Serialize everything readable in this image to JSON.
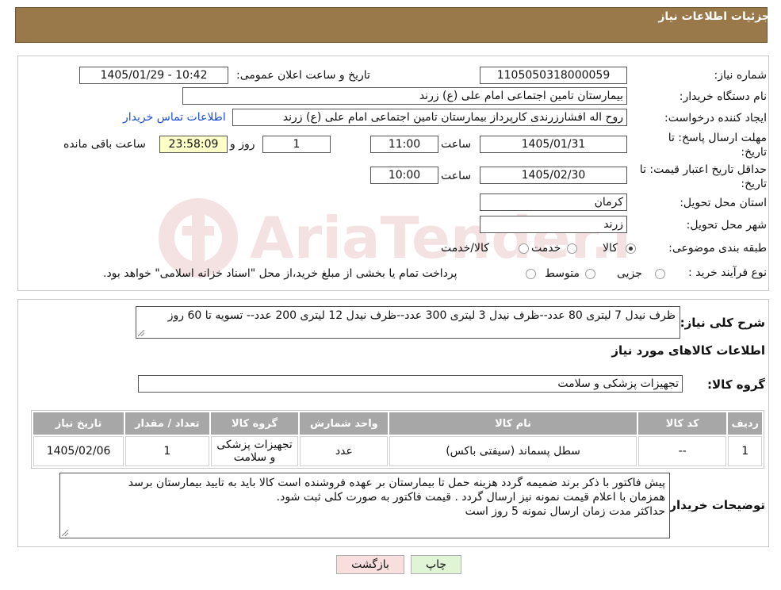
{
  "header": {
    "title": "جزئیات اطلاعات نیاز"
  },
  "fields": {
    "need_number_label": "شماره نیاز:",
    "need_number": "1105050318000059",
    "announce_label": "تاریخ و ساعت اعلان عمومی:",
    "announce_value": "1405/01/29 - 10:42",
    "buyer_org_label": "نام دستگاه خریدار:",
    "buyer_org": "بیمارستان تامین اجتماعی امام علی (ع) زرند",
    "requester_label": "ایجاد کننده درخواست:",
    "requester": "روح اله افشارزرندی کارپرداز بیمارستان تامین اجتماعی امام علی (ع) زرند",
    "contact_link": "اطلاعات تماس خریدار",
    "reply_deadline_label_1": "مهلت ارسال پاسخ: تا",
    "reply_deadline_label_2": "تاریخ:",
    "reply_date": "1405/01/31",
    "time_label": "ساعت",
    "reply_time": "11:00",
    "days_value": "1",
    "days_label": "روز و",
    "remaining_time": "23:58:09",
    "remaining_label": "ساعت باقی مانده",
    "validity_label_1": "حداقل تاریخ اعتبار قیمت: تا",
    "validity_label_2": "تاریخ:",
    "validity_date": "1405/02/30",
    "validity_time": "10:00",
    "province_label": "استان محل تحویل:",
    "province": "کرمان",
    "city_label": "شهر محل تحویل:",
    "city": "زرند",
    "category_label": "طبقه بندی موضوعی:",
    "category_options": [
      "کالا",
      "خدمت",
      "کالا/خدمت"
    ],
    "category_selected": "کالا",
    "purchase_type_label": "نوع فرآیند خرید :",
    "purchase_options": [
      "جزیی",
      "متوسط"
    ],
    "purchase_note": "پرداخت تمام یا بخشی از مبلغ خرید،از محل \"اسناد خزانه اسلامی\" خواهد بود."
  },
  "description": {
    "label": "شرح کلی نیاز:",
    "text": "ظرف نیدل 7 لیتری 80 عدد--ظرف نیدل 3 لیتری 300 عدد--ظرف نیدل 12 لیتری 200 عدد-- تسویه تا 60 روز"
  },
  "goods": {
    "section_title": "اطلاعات کالاهای مورد نیاز",
    "group_label": "گروه کالا:",
    "group_value": "تجهیزات پزشکی و سلامت",
    "columns": [
      "ردیف",
      "کد کالا",
      "نام کالا",
      "واحد شمارش",
      "گروه کالا",
      "تعداد / مقدار",
      "تاریخ نیاز"
    ],
    "rows": [
      [
        "1",
        "--",
        "سطل پسماند (سیفتی باکس)",
        "عدد",
        "تجهیزات پزشکی و سلامت",
        "1",
        "1405/02/06"
      ]
    ]
  },
  "buyer_notes": {
    "label": "توضیحات خریدار:",
    "lines": [
      "پیش فاکتور با ذکر برند ضمیمه گردد هزینه حمل تا بیمارستان بر عهده فروشنده است کالا باید به تایید بیمارستان برسد",
      "همزمان با اعلام قیمت نمونه نیز ارسال گردد . قیمت فاکتور به صورت کلی ثبت شود.",
      "حداکثر مدت زمان ارسال نمونه 5 روز است"
    ]
  },
  "buttons": {
    "print": "چاپ",
    "back": "بازگشت"
  },
  "watermark": {
    "text": "AriaTender.neT"
  },
  "colors": {
    "header_bg": "#99784a",
    "table_header_bg": "#a7a7a7",
    "print_bg": "#dff5d6",
    "back_bg": "#f9dede",
    "link": "#1a4fd6"
  }
}
